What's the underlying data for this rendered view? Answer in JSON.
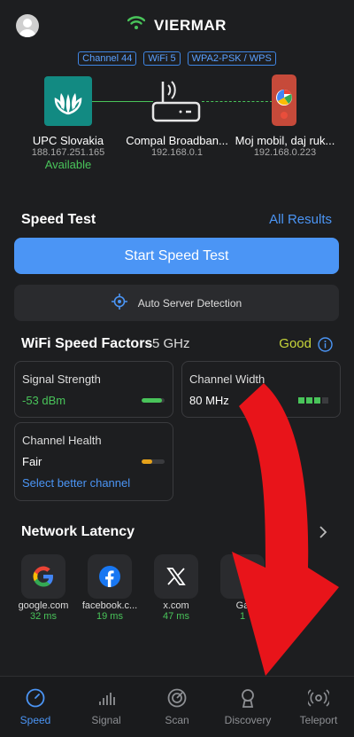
{
  "header": {
    "ssid": "VIERMAR"
  },
  "tags": [
    "Channel 44",
    "WiFi 5",
    "WPA2-PSK / WPS"
  ],
  "devices": [
    {
      "name": "UPC Slovakia",
      "ip": "188.167.251.165",
      "status": "Available"
    },
    {
      "name": "Compal Broadban...",
      "ip": "192.168.0.1"
    },
    {
      "name": "Moj mobil, daj ruk...",
      "ip": "192.168.0.223"
    }
  ],
  "speed_test": {
    "title": "Speed Test",
    "all_results": "All Results",
    "start_button": "Start Speed Test",
    "auto_server": "Auto Server Detection"
  },
  "factors": {
    "title": "WiFi Speed Factors",
    "band": "5 GHz",
    "rating": "Good",
    "signal": {
      "label": "Signal Strength",
      "value": "-53 dBm",
      "level": 0.9
    },
    "width": {
      "label": "Channel Width",
      "value": "80 MHz"
    },
    "health": {
      "label": "Channel Health",
      "value": "Fair",
      "level": 0.45,
      "action": "Select better channel"
    }
  },
  "latency": {
    "title": "Network Latency",
    "items": [
      {
        "name": "google.com",
        "ms": "32 ms"
      },
      {
        "name": "facebook.c...",
        "ms": "19 ms"
      },
      {
        "name": "x.com",
        "ms": "47 ms"
      },
      {
        "name": "Ga",
        "ms": "1"
      }
    ]
  },
  "nav": [
    "Speed",
    "Signal",
    "Scan",
    "Discovery",
    "Teleport"
  ],
  "colors": {
    "accent": "#4b95f5",
    "good": "#49c45a",
    "warn": "#e6a21a",
    "rating": "#c8d63a",
    "arrow": "#e8141a"
  }
}
